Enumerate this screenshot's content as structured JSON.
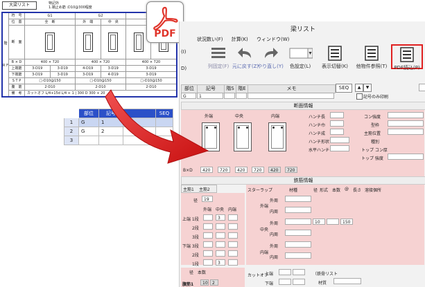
{
  "document": {
    "title": "大梁リスト",
    "note_line1": "特記外",
    "note_line2": "1.端止め筋 :D10@300程度",
    "col_num": "符　号",
    "col_pos": "位　置",
    "col_sec": "断　面",
    "col_bd": "B × D",
    "col_top": "上端筋",
    "col_bot": "下端筋",
    "col_stp": "S T P",
    "col_web": "腹　筋",
    "col_note": "備　考",
    "side_label": "階",
    "side_floor": "R F",
    "beams": [
      {
        "name": "G1",
        "pos_a": "全　断",
        "pos_b": "",
        "bd": "400 × 720",
        "top_a": "3-D19",
        "top_b": "3-D19",
        "bot_a": "3-D19",
        "bot_b": "3-D19",
        "stp": "□-D10@150",
        "web": "2-D10",
        "note": "カットオフ L/4+15d L/4 + 1 | 300 D 300 + 20"
      },
      {
        "name": "G2",
        "pos_a": "外　端",
        "pos_b": "中　央",
        "bd": "400 × 720",
        "top_a": "4-D19",
        "top_b": "3-D19",
        "bot_a": "3-D19",
        "bot_b": "4-D19",
        "stp": "□-D10@150",
        "web": "2-D10",
        "note": ""
      },
      {
        "name": "",
        "pos_a": "全　断",
        "pos_b": "",
        "bd": "400 × 720",
        "top_a": "3-D19",
        "top_b": "",
        "bot_a": "3-D19",
        "bot_b": "",
        "stp": "□-D10@150",
        "web": "2-D10",
        "note": ""
      }
    ]
  },
  "grid": {
    "headers": [
      "部位",
      "記号",
      "",
      "SEQ"
    ],
    "rows": [
      {
        "num": "1",
        "part": "G",
        "code": "1"
      },
      {
        "num": "2",
        "part": "G",
        "code": "2"
      },
      {
        "num": "3",
        "part": "",
        "code": ""
      }
    ]
  },
  "pdf_icon": {
    "label": "PDF",
    "color": "#e0352b"
  },
  "app": {
    "title": "梁リスト",
    "menu": [
      "状況数い(F)",
      "計算(K)",
      "ウィンドウ(W)"
    ],
    "toolbar": [
      {
        "label": "列固定(F)"
      },
      {
        "label": "元に戻す(Z)"
      },
      {
        "label": "やり直し(Y)"
      },
      {
        "label": "色設定(L)"
      },
      {
        "label": "表示切替(K)"
      },
      {
        "label": "他物件参照(T)"
      },
      {
        "label": "PDF読込(P)"
      }
    ],
    "left_stub": [
      "(I)",
      "D)"
    ],
    "col_headers": {
      "part": "部位",
      "code": "記号",
      "f1": "階S",
      "f2": "階E",
      "memo": "メモ",
      "seq": "SEQ"
    },
    "row1_part": "G",
    "row1_code": "1",
    "row1_num": "1",
    "checkbox_label": "記号のみ印刷",
    "section_panel": {
      "header": "断面情報",
      "labels": [
        "外端",
        "中央",
        "内端"
      ],
      "bd_label": "B×D",
      "b_values": [
        "420",
        "420",
        "420"
      ],
      "d_values": [
        "720",
        "720",
        "720"
      ],
      "mid_labels": [
        "ハンチ長",
        "ハンチ巾",
        "ハンチ成",
        "ハンチ形状",
        "水平ハンチ"
      ],
      "right_labels": [
        "コン強度",
        "型枠",
        "主筋位置",
        "種別",
        "トップ コン厚",
        "トップ 強度"
      ]
    },
    "rebar_panel": {
      "header": "鉄筋情報",
      "tabs": [
        "主筋1",
        "主筋2"
      ],
      "dia_label": "径",
      "dia_value": "19",
      "cols": [
        "外端",
        "中央",
        "内端"
      ],
      "rows": [
        "上端 1段",
        "2段",
        "3段",
        "下端 3段",
        "2段",
        "1段"
      ],
      "top1_mid": "3",
      "bot1_mid": "3",
      "stirrup_label": "スターラップ",
      "stirrup_cols": [
        "材種",
        "径",
        "形式",
        "本数",
        "@",
        "長さ",
        "溶接個所"
      ],
      "stirrup_groups": [
        {
          "name": "外端",
          "sub": [
            "外周",
            "内周"
          ]
        },
        {
          "name": "中央",
          "sub": [
            "外周",
            "内周"
          ]
        },
        {
          "name": "内端",
          "sub": [
            "外周",
            "内周"
          ]
        }
      ],
      "mid_dia": "10",
      "mid_pitch": "150",
      "web_label": "腹筋1",
      "web_dia_label": "径　本数",
      "web_dia": "10",
      "web_count": "2",
      "cutoff_label": "カットオフ",
      "cutoff_rows": [
        "上端",
        "下端"
      ],
      "steel_list_label": "（鉄骨リスト",
      "steel_material": "材質"
    }
  },
  "colors": {
    "grid_header": "#2b50c8",
    "pink": "#f6d2d2",
    "arrow": "#d81e1e",
    "highlight": "#e02020"
  }
}
